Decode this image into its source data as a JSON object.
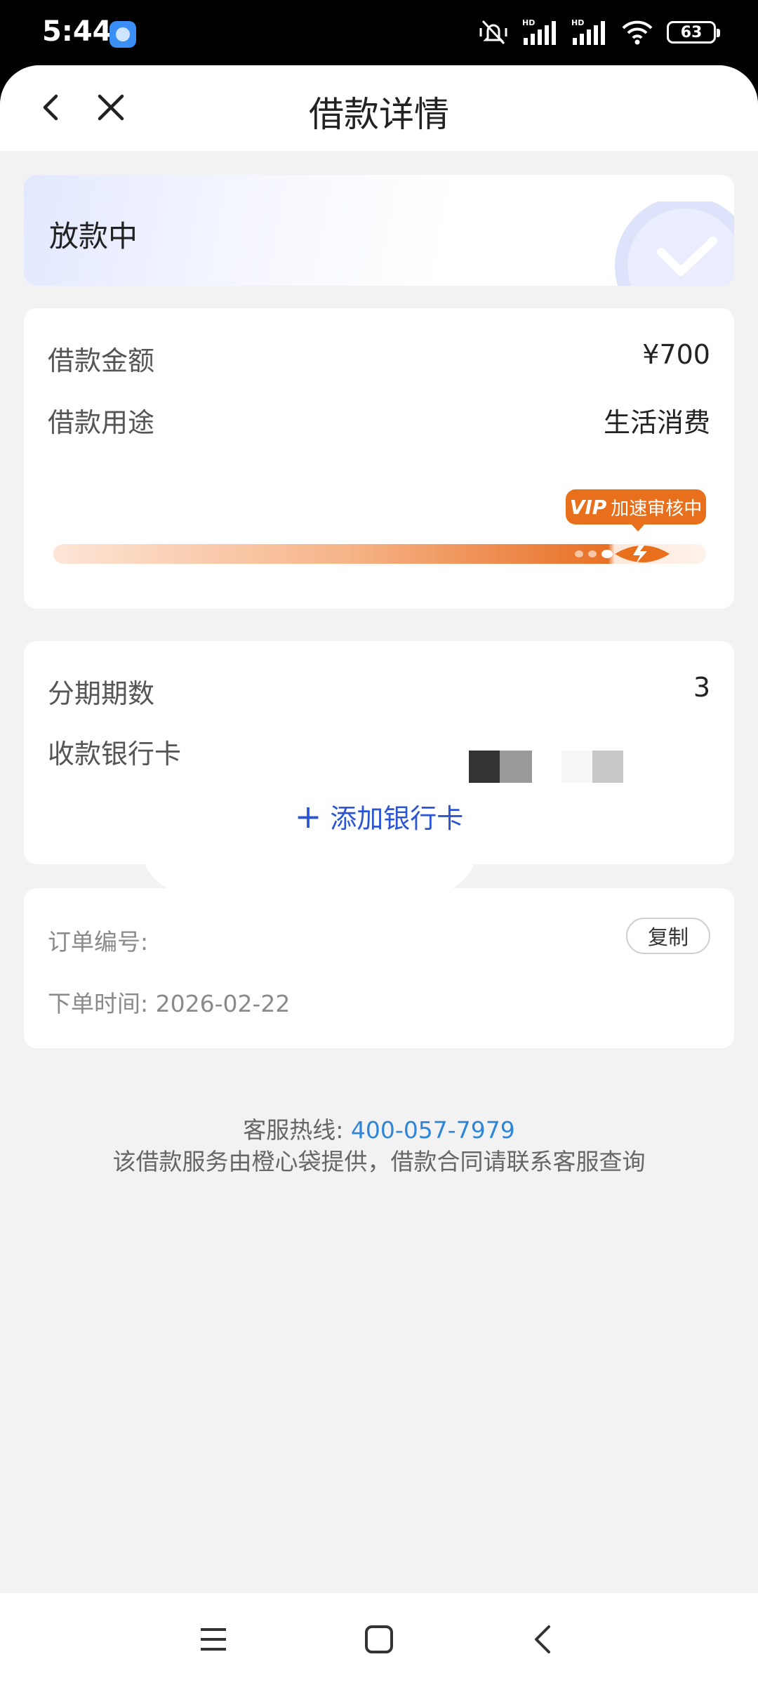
{
  "status_bar": {
    "time": "5:44",
    "battery": "63"
  },
  "nav": {
    "title": "借款详情"
  },
  "loan_status": {
    "text": "放款中"
  },
  "loan_info": {
    "amount_label": "借款金额",
    "amount_value": "¥700",
    "purpose_label": "借款用途",
    "purpose_value": "生活消费",
    "vip_mark": "VIP",
    "vip_text": "加速审核中",
    "progress": 0.95
  },
  "installment": {
    "periods_label": "分期期数",
    "periods_value": "3",
    "bank_label": "收款银行卡",
    "add_card": "添加银行卡"
  },
  "order": {
    "id_label": "订单编号:",
    "copy": "复制",
    "time_label": "下单时间:",
    "time_value": "2026-02-22"
  },
  "footer": {
    "hotline_label": "客服热线:",
    "hotline_number": "400-057-7979",
    "notice": "该借款服务由橙心袋提供，借款合同请联系客服查询"
  },
  "colors": {
    "accent_orange": "#e8701d",
    "link_blue": "#2b55d2",
    "hotline_blue": "#2f86d8"
  }
}
